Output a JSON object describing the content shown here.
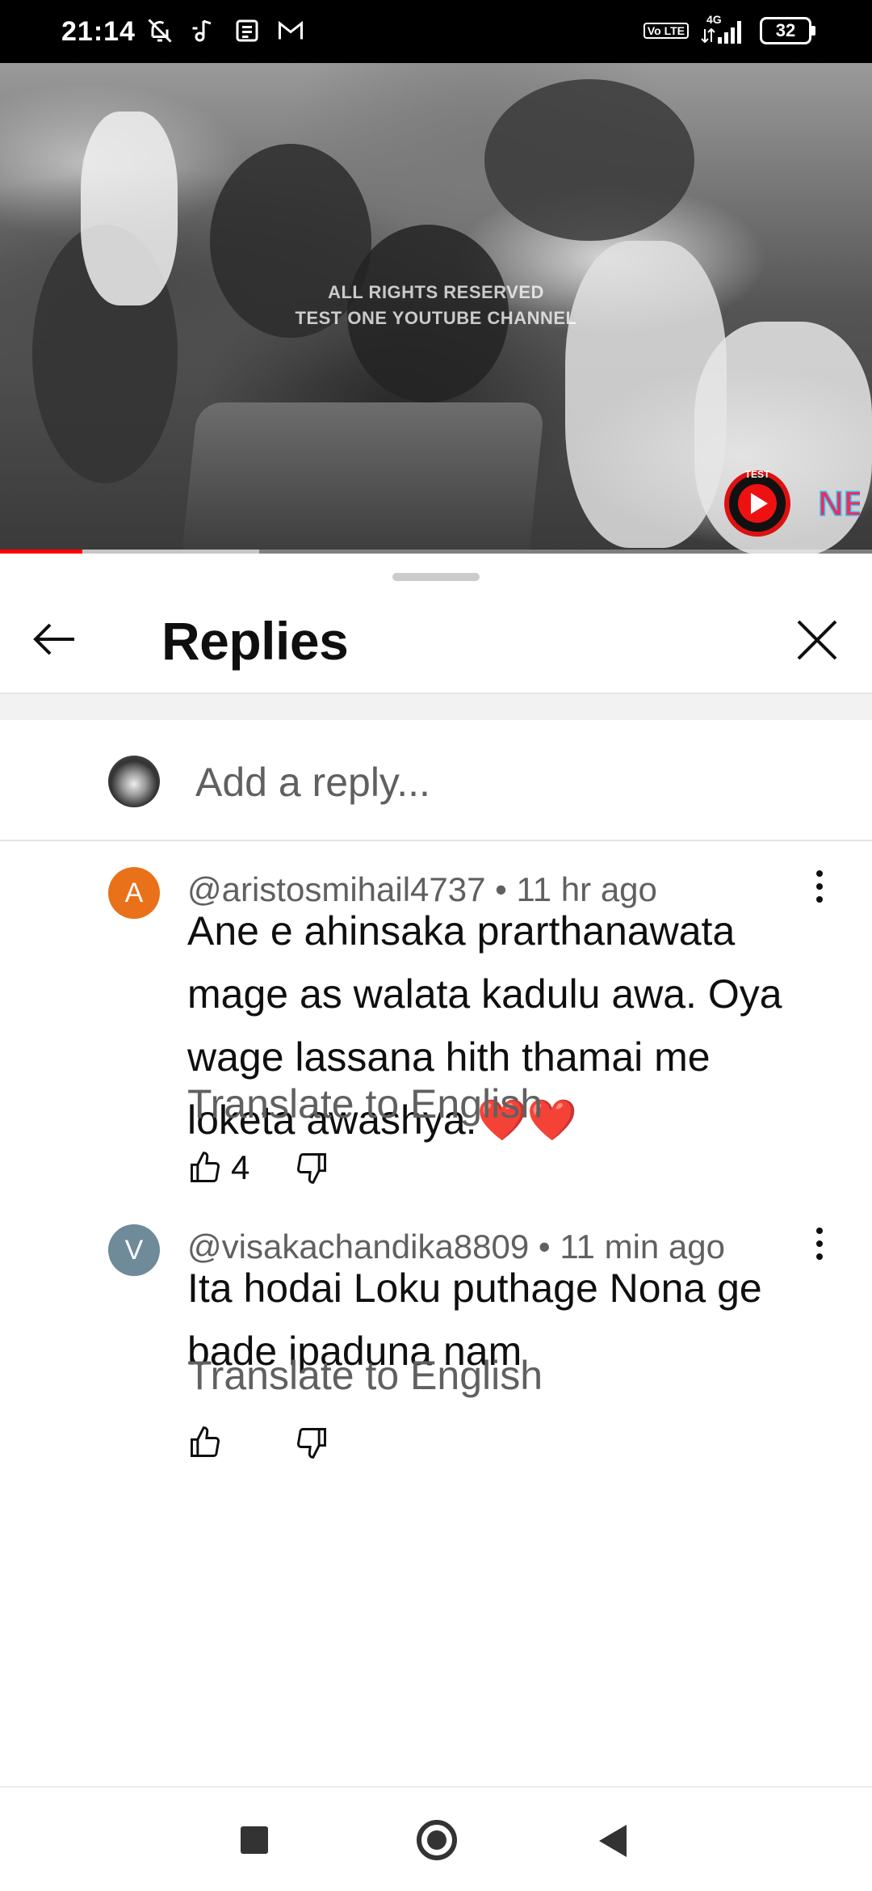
{
  "status_bar": {
    "time": "21:14",
    "left_icons": [
      "notifications-off-icon",
      "music-note-icon",
      "news-icon",
      "gmail-icon"
    ],
    "volte": "Vo LTE",
    "network": "4G",
    "battery": "32"
  },
  "video": {
    "watermark_line1": "ALL RIGHTS RESERVED",
    "watermark_line2": "TEST ONE YOUTUBE CHANNEL",
    "logo_text": "NE",
    "logo_ring_text": "TEST",
    "progress_played": 0.094,
    "progress_buffered": 0.297
  },
  "sheet": {
    "title": "Replies",
    "reply_placeholder": "Add a reply..."
  },
  "comments": [
    {
      "avatar_letter": "A",
      "avatar_color": "#e8711a",
      "author": "@aristosmihail4737",
      "separator": "•",
      "time": "11 hr ago",
      "text": "Ane e ahinsaka prarthanawata mage as walata kadulu awa. Oya wage lassana hith thamai me loketa awashya.",
      "emoji": "❤️❤️",
      "translate": "Translate to English",
      "likes": "4"
    },
    {
      "avatar_letter": "V",
      "avatar_color": "#6f8a99",
      "author": "@visakachandika8809",
      "separator": "•",
      "time": "11 min ago",
      "text": "Ita hodai Loku puthage Nona ge bade ipaduna nam",
      "translate": "Translate to English",
      "likes": ""
    }
  ],
  "colors": {
    "progress_red": "#ff0000",
    "secondary_text": "#606060"
  }
}
